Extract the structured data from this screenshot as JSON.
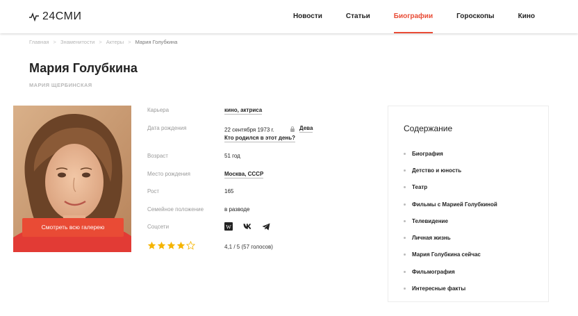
{
  "header": {
    "logo": "24СМИ",
    "nav": [
      {
        "label": "Новости",
        "active": false
      },
      {
        "label": "Статьи",
        "active": false
      },
      {
        "label": "Биографии",
        "active": true
      },
      {
        "label": "Гороскопы",
        "active": false
      },
      {
        "label": "Кино",
        "active": false
      }
    ]
  },
  "breadcrumb": [
    "Главная",
    "Знаменитости",
    "Актеры",
    "Мария Голубкина"
  ],
  "page": {
    "title": "Мария Голубкина",
    "subtitle": "МАРИЯ ЩЕРБИНСКАЯ",
    "gallery_button": "Смотреть всю галерею"
  },
  "facts": {
    "career": {
      "label": "Карьера",
      "value": "кино, актриса"
    },
    "birth": {
      "label": "Дата рождения",
      "value": "22 сентября 1973 г.",
      "zodiac": "Дева",
      "born_link": "Кто родился в этот день?"
    },
    "age": {
      "label": "Возраст",
      "value": "51 год"
    },
    "birthplace": {
      "label": "Место рождения",
      "value": "Москва, СССР"
    },
    "height": {
      "label": "Рост",
      "value": "165"
    },
    "marital": {
      "label": "Семейное положение",
      "value": "в разводе"
    },
    "social": {
      "label": "Соцсети",
      "icons": [
        "wikipedia-icon",
        "vk-icon",
        "telegram-icon"
      ]
    }
  },
  "rating": {
    "stars_filled": 4,
    "stars_total": 5,
    "text": "4,1 / 5 (57 голосов)"
  },
  "toc": {
    "title": "Содержание",
    "items": [
      "Биография",
      "Детство и юность",
      "Театр",
      "Фильмы с Марией Голубкиной",
      "Телевидение",
      "Личная жизнь",
      "Мария Голубкина сейчас",
      "Фильмография",
      "Интересные факты"
    ]
  },
  "colors": {
    "accent": "#e94b35",
    "text": "#222222",
    "muted": "#9a9a9a",
    "star": "#f5b400"
  }
}
